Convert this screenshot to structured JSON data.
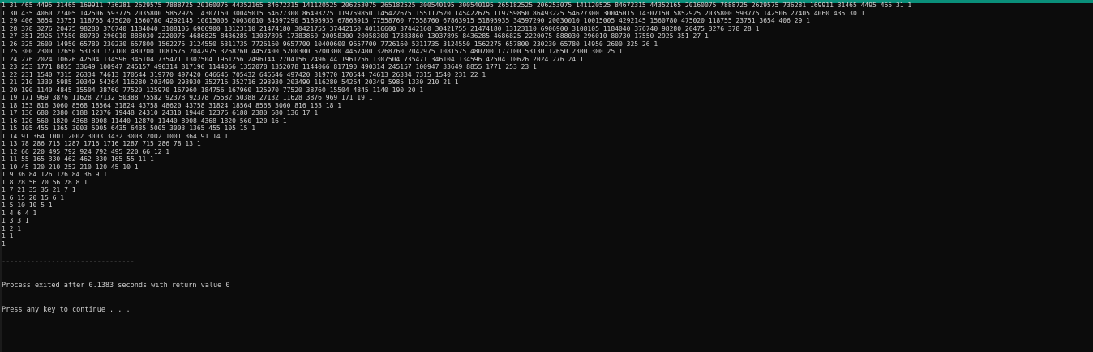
{
  "console": {
    "accent_color": "#0a8f7a",
    "rows": [
      "1 31 465 4495 31465 169911 736281 2629575 7888725 20160075 44352165 84672315 141120525 206253075 265182525 300540195 300540195 265182525 206253075 141120525 84672315 44352165 20160075 7888725 2629575 736281 169911 31465 4495 465 31 1",
      "1 30 435 4060 27405 142506 593775 2035800 5852925 14307150 30045015 54627300 86493225 119759850 145422675 155117520 145422675 119759850 86493225 54627300 30045015 14307150 5852925 2035800 593775 142506 27405 4060 435 30 1",
      "1 29 406 3654 23751 118755 475020 1560780 4292145 10015005 20030010 34597290 51895935 67863915 77558760 77558760 67863915 51895935 34597290 20030010 10015005 4292145 1560780 475020 118755 23751 3654 406 29 1",
      "1 28 378 3276 20475 98280 376740 1184040 3108105 6906900 13123110 21474180 30421755 37442160 40116600 37442160 30421755 21474180 13123110 6906900 3108105 1184040 376740 98280 20475 3276 378 28 1",
      "1 27 351 2925 17550 80730 296010 888030 2220075 4686825 8436285 13037895 17383860 20058300 20058300 17383860 13037895 8436285 4686825 2220075 888030 296010 80730 17550 2925 351 27 1",
      "1 26 325 2600 14950 65780 230230 657800 1562275 3124550 5311735 7726160 9657700 10400600 9657700 7726160 5311735 3124550 1562275 657800 230230 65780 14950 2600 325 26 1",
      "1 25 300 2300 12650 53130 177100 480700 1081575 2042975 3268760 4457400 5200300 5200300 4457400 3268760 2042975 1081575 480700 177100 53130 12650 2300 300 25 1",
      "1 24 276 2024 10626 42504 134596 346104 735471 1307504 1961256 2496144 2704156 2496144 1961256 1307504 735471 346104 134596 42504 10626 2024 276 24 1",
      "1 23 253 1771 8855 33649 100947 245157 490314 817190 1144066 1352078 1352078 1144066 817190 490314 245157 100947 33649 8855 1771 253 23 1",
      "1 22 231 1540 7315 26334 74613 170544 319770 497420 646646 705432 646646 497420 319770 170544 74613 26334 7315 1540 231 22 1",
      "1 21 210 1330 5985 20349 54264 116280 203490 293930 352716 352716 293930 203490 116280 54264 20349 5985 1330 210 21 1",
      "1 20 190 1140 4845 15504 38760 77520 125970 167960 184756 167960 125970 77520 38760 15504 4845 1140 190 20 1",
      "1 19 171 969 3876 11628 27132 50388 75582 92378 92378 75582 50388 27132 11628 3876 969 171 19 1",
      "1 18 153 816 3060 8568 18564 31824 43758 48620 43758 31824 18564 8568 3060 816 153 18 1",
      "1 17 136 680 2380 6188 12376 19448 24310 24310 19448 12376 6188 2380 680 136 17 1",
      "1 16 120 560 1820 4368 8008 11440 12870 11440 8008 4368 1820 560 120 16 1",
      "1 15 105 455 1365 3003 5005 6435 6435 5005 3003 1365 455 105 15 1",
      "1 14 91 364 1001 2002 3003 3432 3003 2002 1001 364 91 14 1",
      "1 13 78 286 715 1287 1716 1716 1287 715 286 78 13 1",
      "1 12 66 220 495 792 924 792 495 220 66 12 1",
      "1 11 55 165 330 462 462 330 165 55 11 1",
      "1 10 45 120 210 252 210 120 45 10 1",
      "1 9 36 84 126 126 84 36 9 1",
      "1 8 28 56 70 56 28 8 1",
      "1 7 21 35 35 21 7 1",
      "1 6 15 20 15 6 1",
      "1 5 10 10 5 1",
      "1 4 6 4 1",
      "1 3 3 1",
      "1 2 1",
      "1 1",
      "1"
    ],
    "separator": "--------------------------------",
    "exit_message": "Process exited after 0.1383 seconds with return value 0",
    "continue_prompt": "Press any key to continue . . ."
  }
}
